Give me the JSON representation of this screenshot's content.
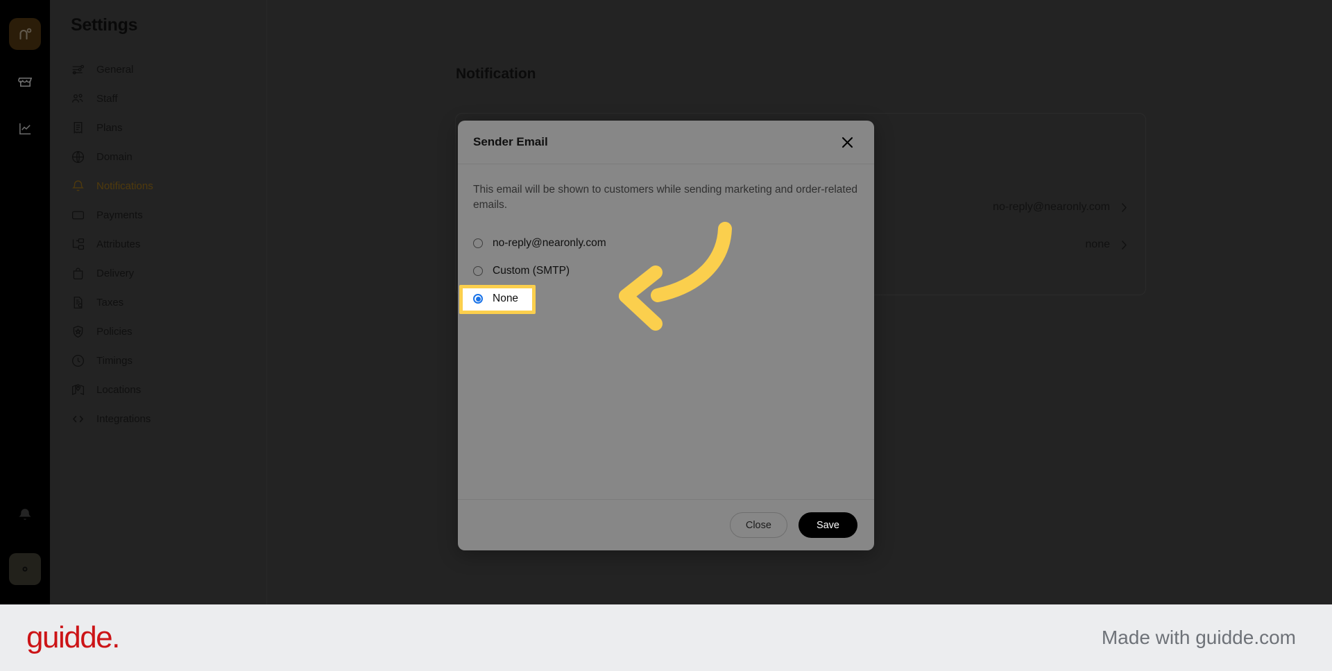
{
  "rail": {
    "logo_alt": "nearonly-logo",
    "items": [
      {
        "name": "store-icon"
      },
      {
        "name": "analytics-icon"
      }
    ],
    "bottom_items": [
      {
        "name": "bell-icon"
      },
      {
        "name": "gear-icon"
      }
    ]
  },
  "sidebar": {
    "title": "Settings",
    "items": [
      {
        "label": "General",
        "icon": "sliders-icon",
        "active": false
      },
      {
        "label": "Staff",
        "icon": "users-icon",
        "active": false
      },
      {
        "label": "Plans",
        "icon": "receipt-icon",
        "active": false
      },
      {
        "label": "Domain",
        "icon": "globe-icon",
        "active": false
      },
      {
        "label": "Notifications",
        "icon": "bell-icon",
        "active": true
      },
      {
        "label": "Payments",
        "icon": "wallet-icon",
        "active": false
      },
      {
        "label": "Attributes",
        "icon": "hierarchy-icon",
        "active": false
      },
      {
        "label": "Delivery",
        "icon": "bag-icon",
        "active": false
      },
      {
        "label": "Taxes",
        "icon": "tax-doc-icon",
        "active": false
      },
      {
        "label": "Policies",
        "icon": "shield-icon",
        "active": false
      },
      {
        "label": "Timings",
        "icon": "clock-icon",
        "active": false
      },
      {
        "label": "Locations",
        "icon": "map-icon",
        "active": false
      },
      {
        "label": "Integrations",
        "icon": "code-icon",
        "active": false
      }
    ]
  },
  "main": {
    "page_title": "Notification",
    "rows": [
      {
        "value": "no-reply@nearonly.com"
      },
      {
        "value": "none"
      }
    ]
  },
  "modal": {
    "title": "Sender Email",
    "close_icon": "close-icon",
    "description": "This email will be shown to customers while sending marketing and order-related emails.",
    "options": [
      {
        "label": "no-reply@nearonly.com",
        "selected": false
      },
      {
        "label": "Custom (SMTP)",
        "selected": false
      },
      {
        "label": "None",
        "selected": true
      }
    ],
    "buttons": {
      "close": "Close",
      "save": "Save"
    }
  },
  "annotation": {
    "arrow_color": "#fbcf4d",
    "highlight_border_color": "#fbcf4d",
    "highlight_fill_color": "#ffffff",
    "radio_accent_color": "#1a73e8"
  },
  "footer": {
    "brand": "guidde.",
    "brand_color": "#cc1417",
    "made_with": "Made with guidde.com"
  }
}
